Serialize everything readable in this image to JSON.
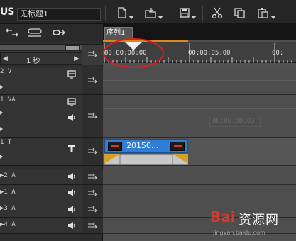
{
  "app": {
    "brand": "US",
    "project_name": "无标题1"
  },
  "toolbar": {
    "icons": [
      "new-file-icon",
      "open-folder-icon",
      "save-icon",
      "cut-icon",
      "copy-icon",
      "paste-icon"
    ]
  },
  "left_panel": {
    "scale": {
      "value": "1 秒",
      "left_glyph": "◀",
      "right_glyph": "▶"
    },
    "tracks": [
      {
        "name": "2 V"
      },
      {
        "name": "1 VA"
      },
      {
        "name": "1 T"
      },
      {
        "name": "▶2 A"
      },
      {
        "name": "▶1 A"
      },
      {
        "name": "▶3 A"
      },
      {
        "name": "▶4 A"
      }
    ]
  },
  "timeline": {
    "sequence_tab": "序列1",
    "ruler": {
      "tc_start": "00:00:00:00",
      "tc_mid": "00:00:05:00",
      "tc_end": "00:"
    },
    "ghost_timecode": "00:00:00:03",
    "clip": {
      "label": "20150..."
    }
  },
  "watermark": {
    "logo": "Bai",
    "text": "资源网",
    "url": "jingyan.baidu.com"
  },
  "colors": {
    "playhead": "#5fe0e0",
    "clip": "#2f7ed6",
    "annotation": "#e11d1d",
    "sequence_bar": "#d88a1b"
  }
}
